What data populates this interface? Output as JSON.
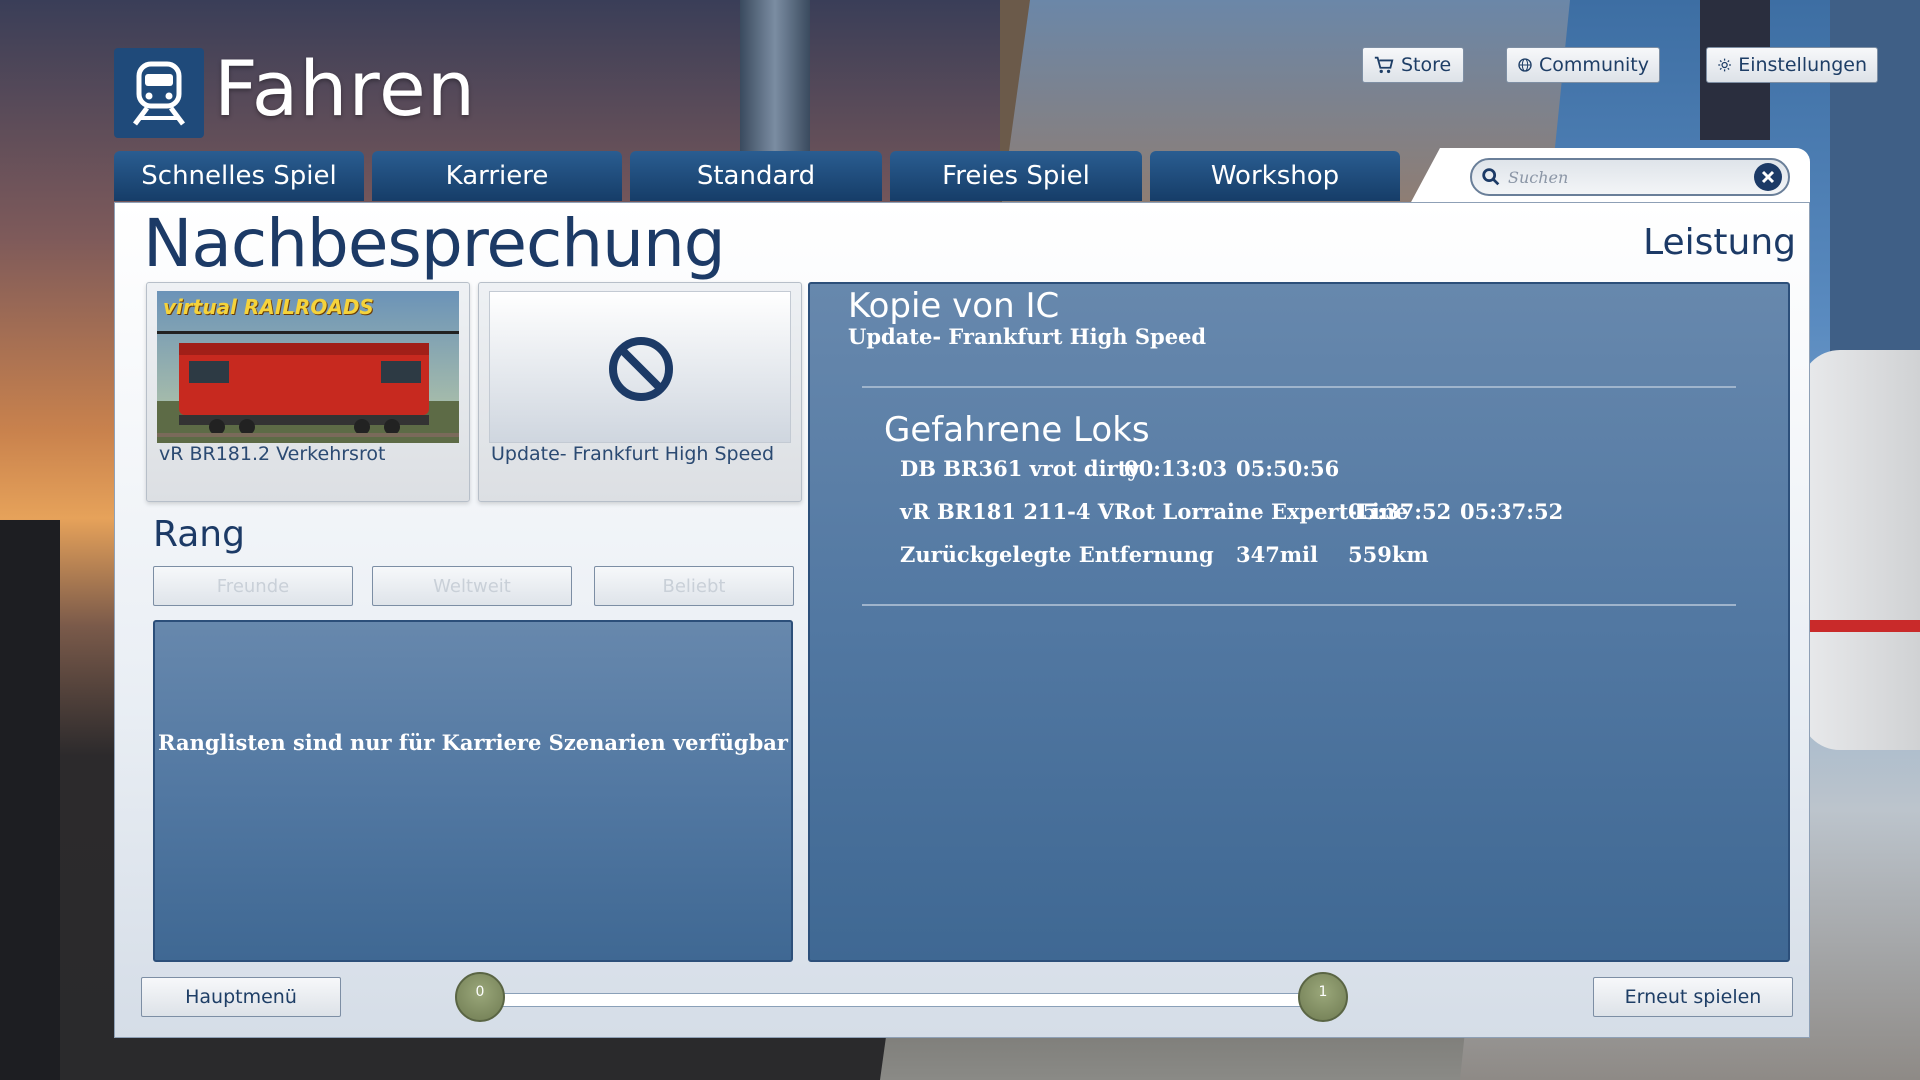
{
  "app": {
    "title": "Fahren"
  },
  "topbar": {
    "store": "Store",
    "community": "Community",
    "settings": "Einstellungen"
  },
  "tabs": [
    "Schnelles Spiel",
    "Karriere",
    "Standard",
    "Freies Spiel",
    "Workshop"
  ],
  "search": {
    "placeholder": "Suchen"
  },
  "page": {
    "title": "Nachbesprechung",
    "section": "Leistung"
  },
  "cards": [
    {
      "label": "vR BR181.2 Verkehrsrot",
      "brand": "virtual RAILROADS"
    },
    {
      "label": "Update- Frankfurt High Speed"
    }
  ],
  "rank": {
    "title": "Rang",
    "buttons": [
      "Freunde",
      "Weltweit",
      "Beliebt"
    ],
    "message": "Ranglisten sind nur für Karriere Szenarien verfügbar"
  },
  "stats": {
    "scenario": "Kopie von IC",
    "route": "Update- Frankfurt High Speed",
    "loks_title": "Gefahrene Loks",
    "rows": [
      {
        "name": "DB BR361 vrot dirty",
        "a": "00:13:03",
        "b": "05:50:56"
      },
      {
        "name": "vR BR181 211-4 VRot Lorraine Expert-Line",
        "a": "05:37:52",
        "b": "05:37:52"
      }
    ],
    "distance": {
      "label": "Zurückgelegte Entfernung",
      "miles": "347mil",
      "km": "559km"
    }
  },
  "footer": {
    "back": "Hauptmenü",
    "replay": "Erneut spielen",
    "slider": {
      "min": "0",
      "max": "1"
    }
  },
  "colors": {
    "accent": "#1f4a7a",
    "panel_blue": "#5278a2",
    "knob": "#7d8a5d"
  }
}
